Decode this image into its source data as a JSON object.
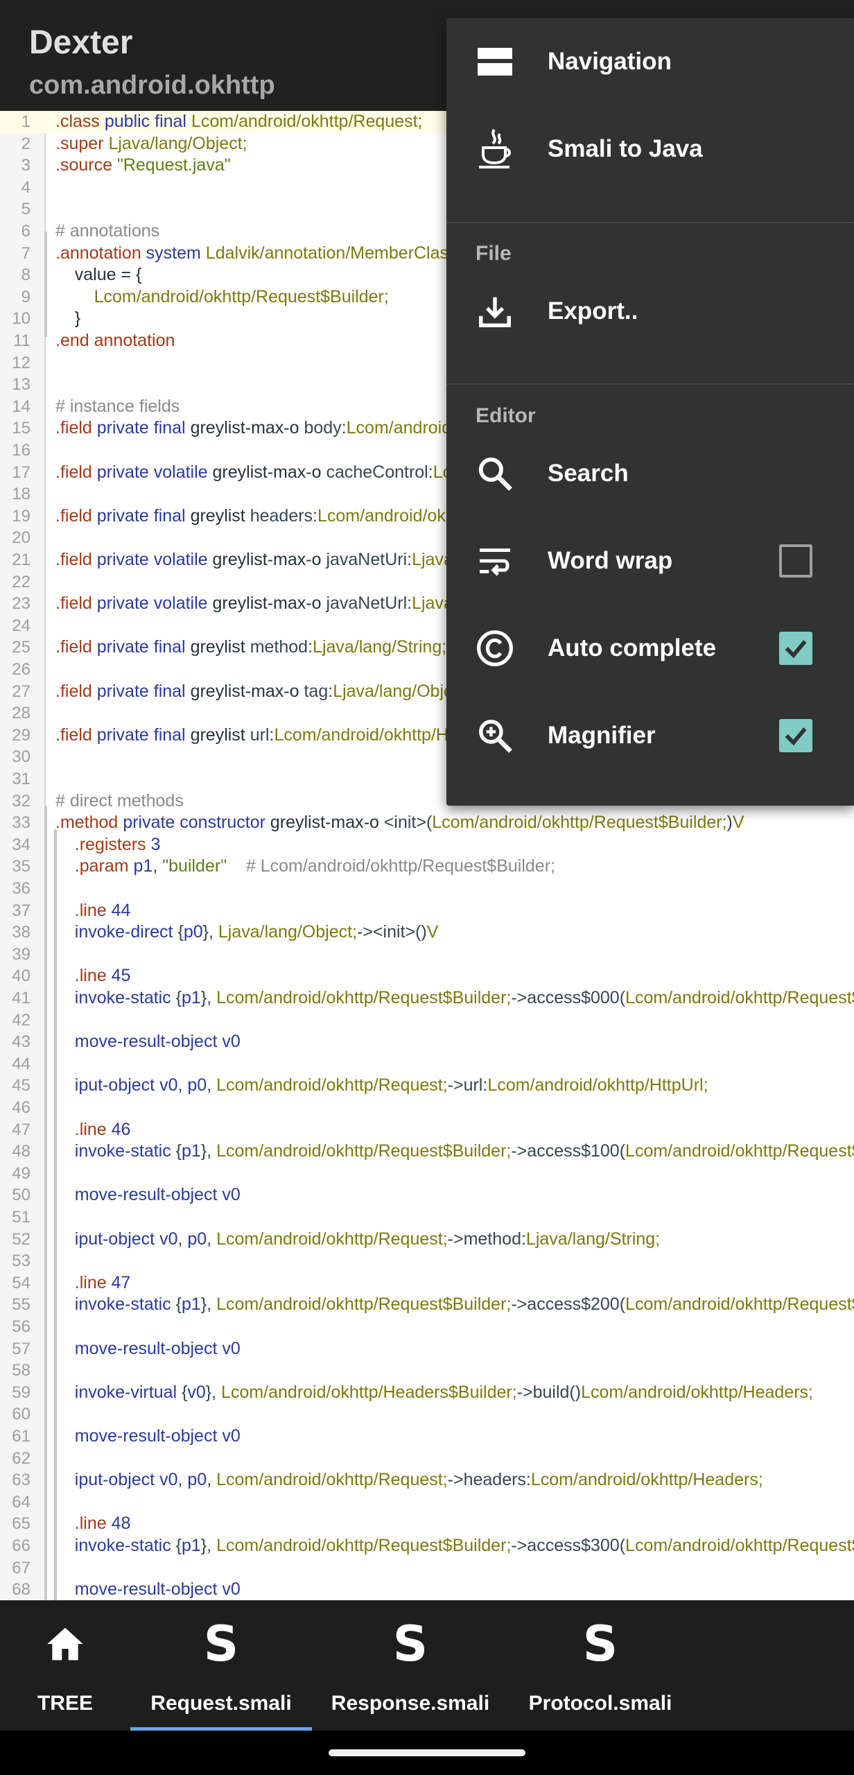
{
  "app": {
    "title": "Dexter",
    "subtitle": "com.android.okhttp"
  },
  "code": {
    "lines": [
      [
        [
          "k-dir",
          ".class "
        ],
        [
          "k-kw",
          "public final "
        ],
        [
          "k-type",
          "Lcom/android/okhttp/Request;"
        ]
      ],
      [
        [
          "k-dir",
          ".super "
        ],
        [
          "k-type",
          "Ljava/lang/Object;"
        ]
      ],
      [
        [
          "k-dir",
          ".source "
        ],
        [
          "k-str",
          "\"Request.java\""
        ]
      ],
      [],
      [],
      [
        [
          "k-cm",
          "# annotations"
        ]
      ],
      [
        [
          "k-dir",
          ".annotation "
        ],
        [
          "k-kw",
          "system "
        ],
        [
          "k-type",
          "Ldalvik/annotation/MemberClasses;"
        ]
      ],
      [
        [
          "k-id",
          "    value = {"
        ]
      ],
      [
        [
          "k-type",
          "        Lcom/android/okhttp/Request$Builder;"
        ]
      ],
      [
        [
          "k-id",
          "    }"
        ]
      ],
      [
        [
          "k-dir",
          ".end annotation"
        ]
      ],
      [],
      [],
      [
        [
          "k-cm",
          "# instance fields"
        ]
      ],
      [
        [
          "k-dir",
          ".field "
        ],
        [
          "k-kw",
          "private final "
        ],
        [
          "k-id",
          "greylist-max-o "
        ],
        [
          "k-op",
          "body:"
        ],
        [
          "k-type",
          "Lcom/android/okhttp/RequestBody;"
        ]
      ],
      [],
      [
        [
          "k-dir",
          ".field "
        ],
        [
          "k-kw",
          "private volatile "
        ],
        [
          "k-id",
          "greylist-max-o "
        ],
        [
          "k-op",
          "cacheControl:"
        ],
        [
          "k-type",
          "Lcom/android/okhttp/CacheControl;"
        ]
      ],
      [],
      [
        [
          "k-dir",
          ".field "
        ],
        [
          "k-kw",
          "private final "
        ],
        [
          "k-id",
          "greylist "
        ],
        [
          "k-op",
          "headers:"
        ],
        [
          "k-type",
          "Lcom/android/okhttp/Headers;"
        ]
      ],
      [],
      [
        [
          "k-dir",
          ".field "
        ],
        [
          "k-kw",
          "private volatile "
        ],
        [
          "k-id",
          "greylist-max-o "
        ],
        [
          "k-op",
          "javaNetUri:"
        ],
        [
          "k-type",
          "Ljava/net/URI;"
        ]
      ],
      [],
      [
        [
          "k-dir",
          ".field "
        ],
        [
          "k-kw",
          "private volatile "
        ],
        [
          "k-id",
          "greylist-max-o "
        ],
        [
          "k-op",
          "javaNetUrl:"
        ],
        [
          "k-type",
          "Ljava/net/URL;"
        ]
      ],
      [],
      [
        [
          "k-dir",
          ".field "
        ],
        [
          "k-kw",
          "private final "
        ],
        [
          "k-id",
          "greylist "
        ],
        [
          "k-op",
          "method:"
        ],
        [
          "k-type",
          "Ljava/lang/String;"
        ]
      ],
      [],
      [
        [
          "k-dir",
          ".field "
        ],
        [
          "k-kw",
          "private final "
        ],
        [
          "k-id",
          "greylist-max-o "
        ],
        [
          "k-op",
          "tag:"
        ],
        [
          "k-type",
          "Ljava/lang/Object;"
        ]
      ],
      [],
      [
        [
          "k-dir",
          ".field "
        ],
        [
          "k-kw",
          "private final "
        ],
        [
          "k-id",
          "greylist "
        ],
        [
          "k-op",
          "url:"
        ],
        [
          "k-type",
          "Lcom/android/okhttp/HttpUrl;"
        ]
      ],
      [],
      [],
      [
        [
          "k-cm",
          "# direct methods"
        ]
      ],
      [
        [
          "k-dir",
          ".method "
        ],
        [
          "k-kw",
          "private constructor "
        ],
        [
          "k-id",
          "greylist-max-o "
        ],
        [
          "k-op",
          "<init>("
        ],
        [
          "k-type",
          "Lcom/android/okhttp/Request$Builder;"
        ],
        [
          "k-op",
          ")"
        ],
        [
          "k-type",
          "V"
        ]
      ],
      [
        [
          "k-dir",
          "    .registers "
        ],
        [
          "k-num",
          "3"
        ]
      ],
      [
        [
          "k-dir",
          "    .param "
        ],
        [
          "k-reg",
          "p1"
        ],
        [
          "k-op",
          ", "
        ],
        [
          "k-str",
          "\"builder\""
        ],
        [
          "k-cm",
          "    # Lcom/android/okhttp/Request$Builder;"
        ]
      ],
      [],
      [
        [
          "k-dir",
          "    .line "
        ],
        [
          "k-num",
          "44"
        ]
      ],
      [
        [
          "k-kw",
          "    invoke-direct "
        ],
        [
          "k-op",
          "{"
        ],
        [
          "k-reg",
          "p0"
        ],
        [
          "k-op",
          "}, "
        ],
        [
          "k-type",
          "Ljava/lang/Object;"
        ],
        [
          "k-op",
          "-><init>()"
        ],
        [
          "k-type",
          "V"
        ]
      ],
      [],
      [
        [
          "k-dir",
          "    .line "
        ],
        [
          "k-num",
          "45"
        ]
      ],
      [
        [
          "k-kw",
          "    invoke-static "
        ],
        [
          "k-op",
          "{"
        ],
        [
          "k-reg",
          "p1"
        ],
        [
          "k-op",
          "}, "
        ],
        [
          "k-type",
          "Lcom/android/okhttp/Request$Builder;"
        ],
        [
          "k-op",
          "->access$000("
        ],
        [
          "k-type",
          "Lcom/android/okhttp/Request$Builder;)"
        ]
      ],
      [],
      [
        [
          "k-kw",
          "    move-result-object "
        ],
        [
          "k-reg",
          "v0"
        ]
      ],
      [],
      [
        [
          "k-kw",
          "    iput-object "
        ],
        [
          "k-reg",
          "v0"
        ],
        [
          "k-op",
          ", "
        ],
        [
          "k-reg",
          "p0"
        ],
        [
          "k-op",
          ", "
        ],
        [
          "k-type",
          "Lcom/android/okhttp/Request;"
        ],
        [
          "k-op",
          "->url:"
        ],
        [
          "k-type",
          "Lcom/android/okhttp/HttpUrl;"
        ]
      ],
      [],
      [
        [
          "k-dir",
          "    .line "
        ],
        [
          "k-num",
          "46"
        ]
      ],
      [
        [
          "k-kw",
          "    invoke-static "
        ],
        [
          "k-op",
          "{"
        ],
        [
          "k-reg",
          "p1"
        ],
        [
          "k-op",
          "}, "
        ],
        [
          "k-type",
          "Lcom/android/okhttp/Request$Builder;"
        ],
        [
          "k-op",
          "->access$100("
        ],
        [
          "k-type",
          "Lcom/android/okhttp/Request$Builder;)"
        ]
      ],
      [],
      [
        [
          "k-kw",
          "    move-result-object "
        ],
        [
          "k-reg",
          "v0"
        ]
      ],
      [],
      [
        [
          "k-kw",
          "    iput-object "
        ],
        [
          "k-reg",
          "v0"
        ],
        [
          "k-op",
          ", "
        ],
        [
          "k-reg",
          "p0"
        ],
        [
          "k-op",
          ", "
        ],
        [
          "k-type",
          "Lcom/android/okhttp/Request;"
        ],
        [
          "k-op",
          "->method:"
        ],
        [
          "k-type",
          "Ljava/lang/String;"
        ]
      ],
      [],
      [
        [
          "k-dir",
          "    .line "
        ],
        [
          "k-num",
          "47"
        ]
      ],
      [
        [
          "k-kw",
          "    invoke-static "
        ],
        [
          "k-op",
          "{"
        ],
        [
          "k-reg",
          "p1"
        ],
        [
          "k-op",
          "}, "
        ],
        [
          "k-type",
          "Lcom/android/okhttp/Request$Builder;"
        ],
        [
          "k-op",
          "->access$200("
        ],
        [
          "k-type",
          "Lcom/android/okhttp/Request$Builder;)"
        ]
      ],
      [],
      [
        [
          "k-kw",
          "    move-result-object "
        ],
        [
          "k-reg",
          "v0"
        ]
      ],
      [],
      [
        [
          "k-kw",
          "    invoke-virtual "
        ],
        [
          "k-op",
          "{"
        ],
        [
          "k-reg",
          "v0"
        ],
        [
          "k-op",
          "}, "
        ],
        [
          "k-type",
          "Lcom/android/okhttp/Headers$Builder;"
        ],
        [
          "k-op",
          "->build()"
        ],
        [
          "k-type",
          "Lcom/android/okhttp/Headers;"
        ]
      ],
      [],
      [
        [
          "k-kw",
          "    move-result-object "
        ],
        [
          "k-reg",
          "v0"
        ]
      ],
      [],
      [
        [
          "k-kw",
          "    iput-object "
        ],
        [
          "k-reg",
          "v0"
        ],
        [
          "k-op",
          ", "
        ],
        [
          "k-reg",
          "p0"
        ],
        [
          "k-op",
          ", "
        ],
        [
          "k-type",
          "Lcom/android/okhttp/Request;"
        ],
        [
          "k-op",
          "->headers:"
        ],
        [
          "k-type",
          "Lcom/android/okhttp/Headers;"
        ]
      ],
      [],
      [
        [
          "k-dir",
          "    .line "
        ],
        [
          "k-num",
          "48"
        ]
      ],
      [
        [
          "k-kw",
          "    invoke-static "
        ],
        [
          "k-op",
          "{"
        ],
        [
          "k-reg",
          "p1"
        ],
        [
          "k-op",
          "}, "
        ],
        [
          "k-type",
          "Lcom/android/okhttp/Request$Builder;"
        ],
        [
          "k-op",
          "->access$300("
        ],
        [
          "k-type",
          "Lcom/android/okhttp/Request$Builder;)"
        ]
      ],
      [],
      [
        [
          "k-kw",
          "    move-result-object "
        ],
        [
          "k-reg",
          "v0"
        ]
      ]
    ]
  },
  "menu": {
    "navigation": "Navigation",
    "smali_to_java": "Smali to Java",
    "section_file": "File",
    "export": "Export..",
    "section_editor": "Editor",
    "search": "Search",
    "word_wrap": "Word wrap",
    "word_wrap_checked": false,
    "auto_complete": "Auto complete",
    "auto_complete_checked": true,
    "magnifier": "Magnifier",
    "magnifier_checked": true
  },
  "tabs": {
    "tree": "TREE",
    "request": "Request.smali",
    "response": "Response.smali",
    "protocol": "Protocol.smali",
    "active": "request"
  },
  "icons": {
    "tree": "home-icon",
    "smali": "smali-s-icon",
    "navigation": "navigation-panel-icon",
    "smali_to_java": "java-cup-icon",
    "export": "download-icon",
    "search": "search-icon",
    "word_wrap": "wrap-text-icon",
    "auto_complete": "copyright-c-icon",
    "magnifier": "zoom-in-icon"
  },
  "colors": {
    "header_bg": "#212121",
    "menu_bg": "#323232",
    "checkbox_on": "#80cbc4",
    "tab_indicator": "#6fa3e0"
  }
}
